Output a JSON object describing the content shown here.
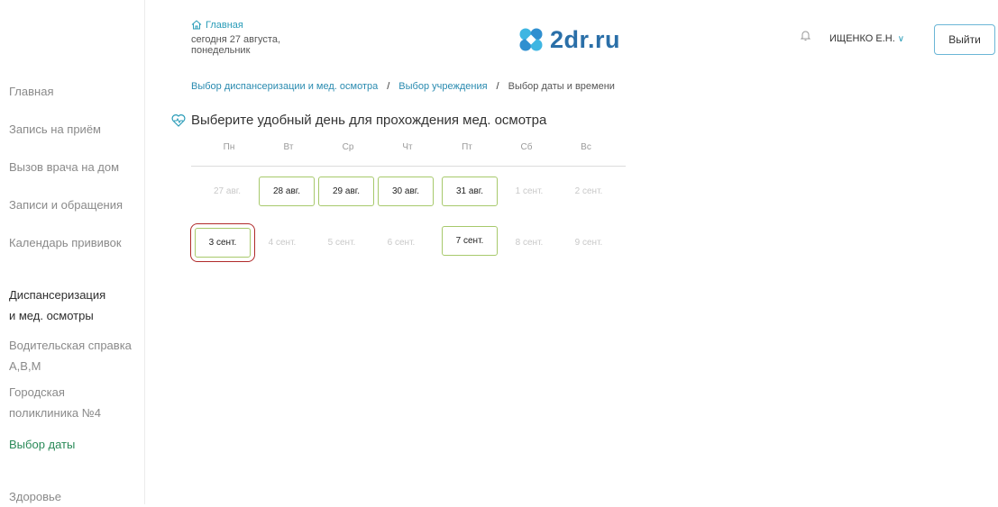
{
  "header": {
    "home_label": "Главная",
    "today_line1": "сегодня 27 августа,",
    "today_line2": "понедельник",
    "logo_text": "2dr.ru",
    "user_name": "ИЩЕНКО Е.Н.",
    "logout_label": "Выйти"
  },
  "sidebar": {
    "items": [
      {
        "label": "Главная"
      },
      {
        "label": "Запись на приём"
      },
      {
        "label": "Вызов врача на дом"
      },
      {
        "label": "Записи и обращения"
      },
      {
        "label": "Календарь прививок"
      },
      {
        "label1": "Диспансеризация",
        "label2": "и мед. осмотры"
      },
      {
        "label1": "Водительская справка",
        "label2": "А,В,М"
      },
      {
        "label1": "Городская",
        "label2": "поликлиника №4"
      },
      {
        "label": "Выбор даты"
      },
      {
        "label": "Здоровье"
      }
    ]
  },
  "breadcrumb": {
    "step1": "Выбор диспансеризации и мед. осмотра",
    "sep": "/",
    "step2": "Выбор учреждения",
    "step3": "Выбор даты и времени"
  },
  "heading": "Выберите удобный день для прохождения мед. осмотра",
  "calendar": {
    "weekdays": [
      "Пн",
      "Вт",
      "Ср",
      "Чт",
      "Пт",
      "Сб",
      "Вс"
    ],
    "weeks": [
      [
        {
          "label": "27 авг.",
          "available": false
        },
        {
          "label": "28 авг.",
          "available": true
        },
        {
          "label": "29 авг.",
          "available": true
        },
        {
          "label": "30 авг.",
          "available": true
        },
        {
          "label": "31 авг.",
          "available": true
        },
        {
          "label": "1 сент.",
          "available": false
        },
        {
          "label": "2 сент.",
          "available": false
        }
      ],
      [
        {
          "label": "3 сент.",
          "available": true,
          "selected": true
        },
        {
          "label": "4 сент.",
          "available": false
        },
        {
          "label": "5 сент.",
          "available": false
        },
        {
          "label": "6 сент.",
          "available": false
        },
        {
          "label": "7 сент.",
          "available": true
        },
        {
          "label": "8 сент.",
          "available": false
        },
        {
          "label": "9 сент.",
          "available": false
        }
      ]
    ]
  },
  "colors": {
    "accent": "#2a9cb8",
    "available_border": "#a7c96b",
    "selected_outline": "#b02a2a",
    "active_nav": "#2a8a58"
  }
}
